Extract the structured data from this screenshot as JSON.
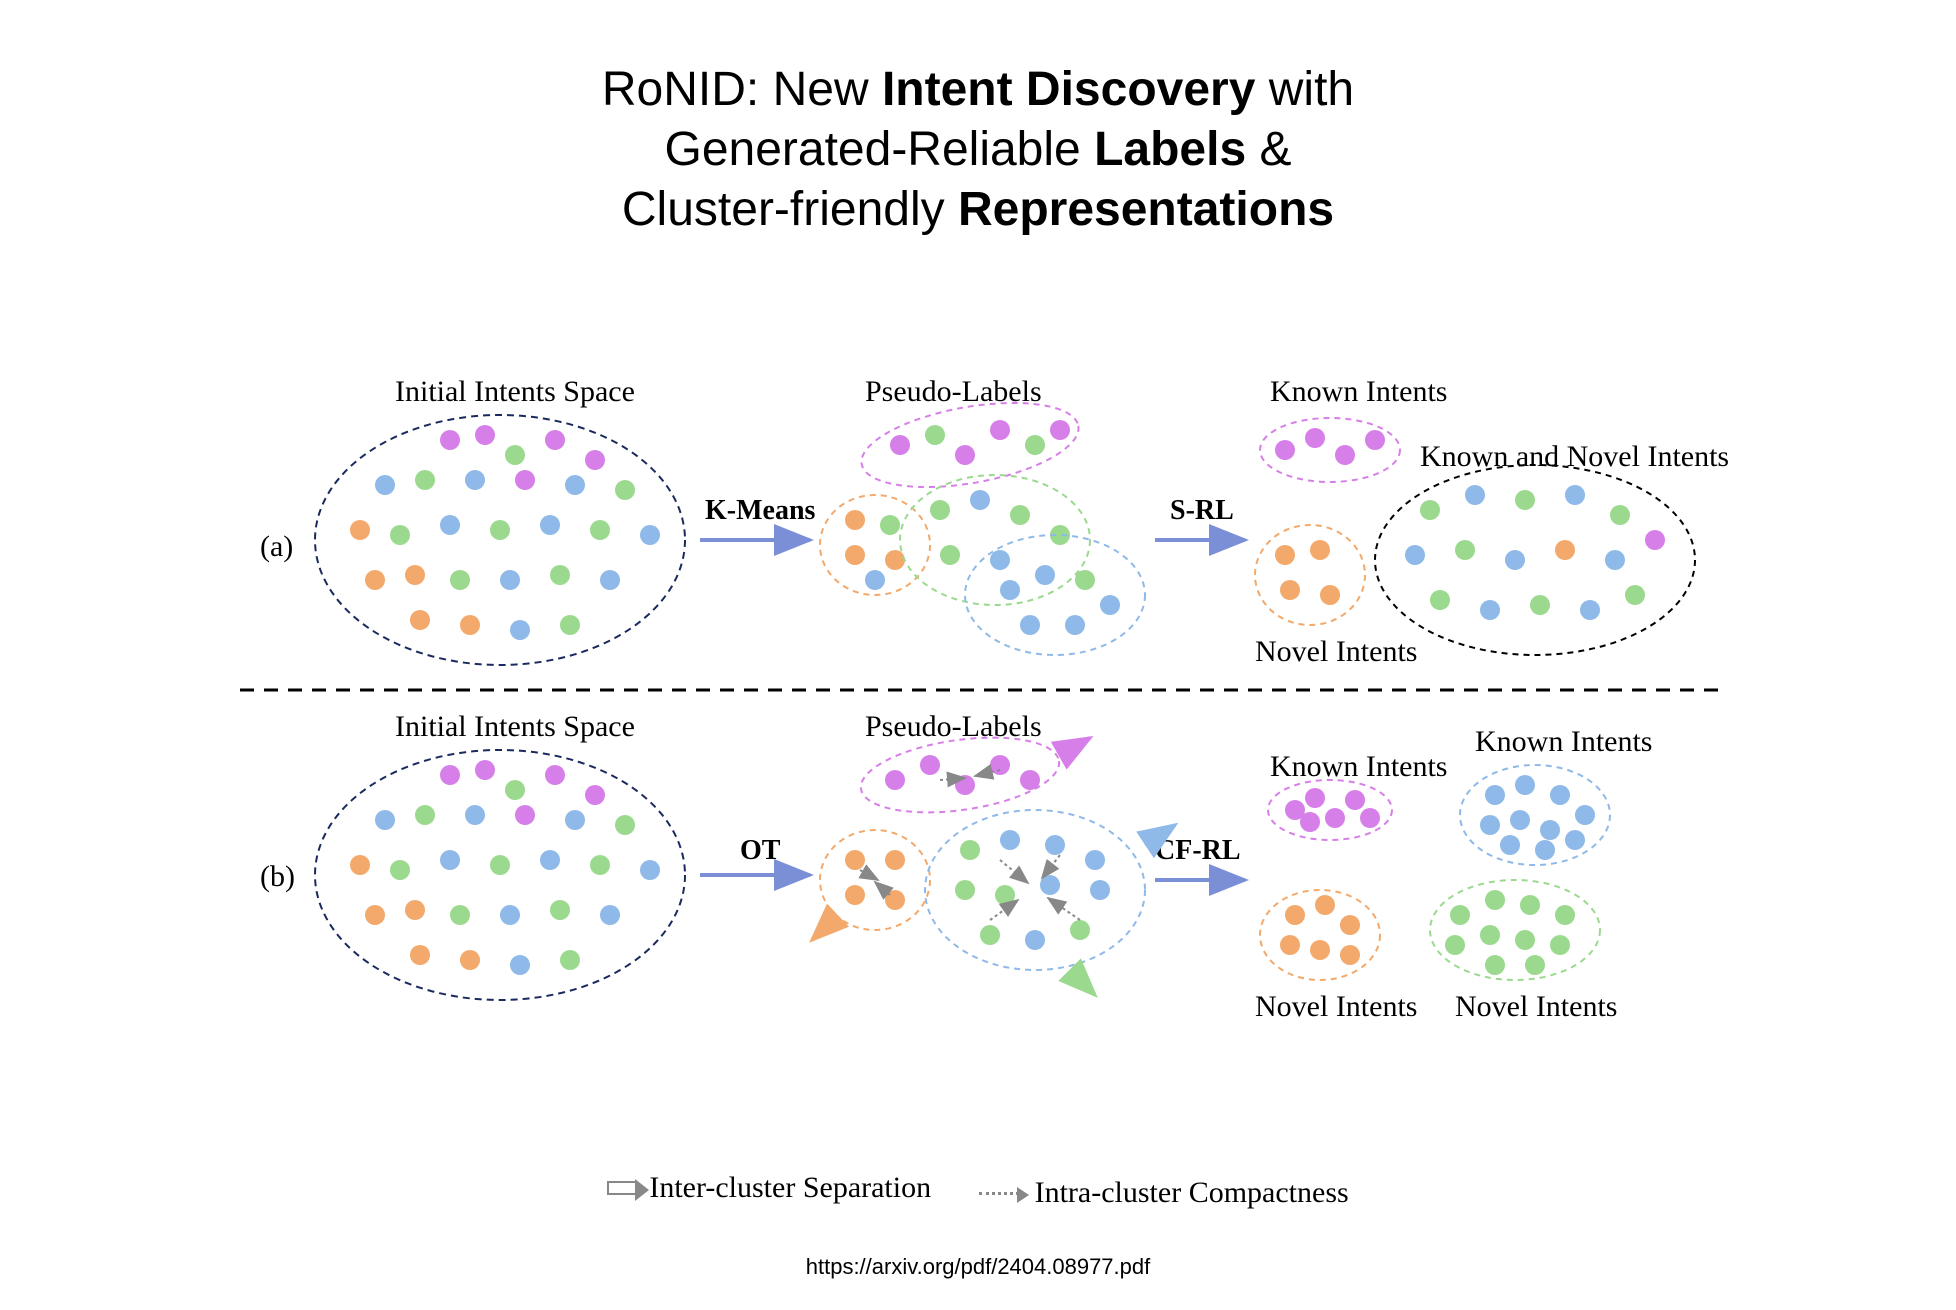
{
  "title": {
    "prefix": "RoNID: New ",
    "bold1": "Intent Discovery",
    "mid1": " with",
    "line2a": "Generated-Reliable ",
    "bold2": "Labels",
    "line2b": " &",
    "line3a": "Cluster-friendly ",
    "bold3": "Representations"
  },
  "rows": {
    "a": "(a)",
    "b": "(b)"
  },
  "captions": {
    "initial_a": "Initial Intents Space",
    "initial_b": "Initial Intents Space",
    "pseudo_a": "Pseudo-Labels",
    "pseudo_b": "Pseudo-Labels",
    "known_a": "Known Intents",
    "known_b1": "Known Intents",
    "known_b2": "Known Intents",
    "novel_a_side": "Novel Intents",
    "known_novel_a": "Known and Novel Intents",
    "novel_b1": "Novel Intents",
    "novel_b2": "Novel Intents"
  },
  "arrows": {
    "kmeans": "K-Means",
    "srl": "S-RL",
    "ot": "OT",
    "cfrl": "CF-RL"
  },
  "legend": {
    "inter": "Inter-cluster Separation",
    "intra": "Intra-cluster Compactness"
  },
  "source": "https://arxiv.org/pdf/2404.08977.pdf",
  "colors": {
    "magenta": "#d77fe8",
    "orange": "#f2a96b",
    "blue": "#8fb9e8",
    "green": "#9bd98f",
    "navy": "#1a2a5e",
    "arrow": "#7a8fd6",
    "gray": "#888888",
    "black": "#000000"
  }
}
